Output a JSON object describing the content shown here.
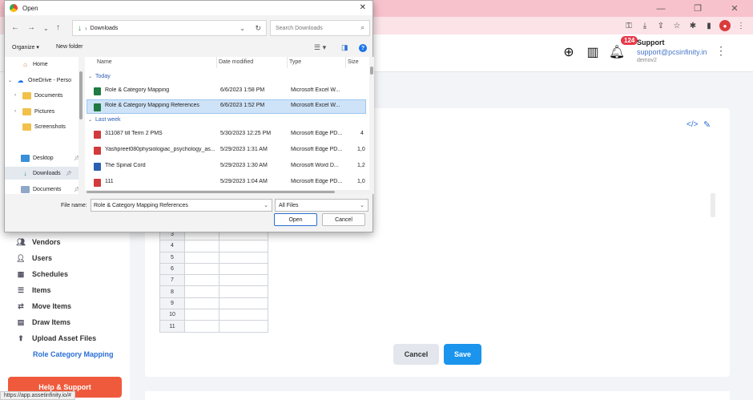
{
  "browser": {
    "status_url": "https://app.assetinfinity.io/#"
  },
  "header": {
    "notification_count": "124",
    "user_name": "Support",
    "user_email": "support@pcsinfinity.in",
    "user_tenant": "demov2"
  },
  "sidebar": {
    "items": [
      {
        "label": "Vendors",
        "icon": "vendors-icon"
      },
      {
        "label": "Users",
        "icon": "users-icon"
      },
      {
        "label": "Schedules",
        "icon": "schedules-icon"
      },
      {
        "label": "Items",
        "icon": "items-icon"
      },
      {
        "label": "Move Items",
        "icon": "move-icon"
      },
      {
        "label": "Draw Items",
        "icon": "draw-icon"
      },
      {
        "label": "Upload Asset Files",
        "icon": "upload-icon"
      },
      {
        "label": "Role Category Mapping",
        "icon": "",
        "active": true
      }
    ],
    "help_label": "Help & Support"
  },
  "main": {
    "row_numbers": [
      "3",
      "4",
      "5",
      "6",
      "7",
      "8",
      "9",
      "10",
      "11"
    ],
    "cancel_label": "Cancel",
    "save_label": "Save"
  },
  "dialog": {
    "title": "Open",
    "close_glyph": "✕",
    "path": "Downloads",
    "search_placeholder": "Search Downloads",
    "organize_label": "Organize ▾",
    "new_folder_label": "New folder",
    "nav": [
      {
        "label": "Home",
        "icon": "home-icon"
      },
      {
        "label": "OneDrive - Perso",
        "icon": "onedrive-icon"
      },
      {
        "label": "Documents",
        "icon": "folder-icon"
      },
      {
        "label": "Pictures",
        "icon": "folder-icon"
      },
      {
        "label": "Screenshots",
        "icon": "folder-icon"
      },
      {
        "label": "Desktop",
        "icon": "desktop-icon"
      },
      {
        "label": "Downloads",
        "icon": "download-icon",
        "selected": true
      },
      {
        "label": "Documents",
        "icon": "documents-icon"
      }
    ],
    "columns": {
      "name": "Name",
      "date": "Date modified",
      "type": "Type",
      "size": "Size"
    },
    "groups": {
      "today": "Today",
      "last_week": "Last week"
    },
    "files": [
      {
        "name": "Role & Category Mapping",
        "date": "6/6/2023 1:58 PM",
        "type": "Microsoft Excel W...",
        "size": "",
        "kind": "xl"
      },
      {
        "name": "Role & Category Mapping References",
        "date": "6/6/2023 1:52 PM",
        "type": "Microsoft Excel W...",
        "size": "",
        "kind": "xl",
        "selected": true
      },
      {
        "name": "311087 till Term 2 PMS",
        "date": "5/30/2023 12:25 PM",
        "type": "Microsoft Edge PD...",
        "size": "4",
        "kind": "pdf"
      },
      {
        "name": "Yashpreet080physiologiac_psychology_as...",
        "date": "5/29/2023 1:31 AM",
        "type": "Microsoft Edge PD...",
        "size": "1,0",
        "kind": "pdf"
      },
      {
        "name": "The Spinal Cord",
        "date": "5/29/2023 1:30 AM",
        "type": "Microsoft Word D...",
        "size": "1,2",
        "kind": "word"
      },
      {
        "name": "111",
        "date": "5/29/2023 1:04 AM",
        "type": "Microsoft Edge PD...",
        "size": "1,0",
        "kind": "pdf"
      }
    ],
    "file_name_label": "File name:",
    "file_name_value": "Role & Category Mapping References",
    "file_type_value": "All Files",
    "open_label": "Open",
    "cancel_label": "Cancel"
  }
}
